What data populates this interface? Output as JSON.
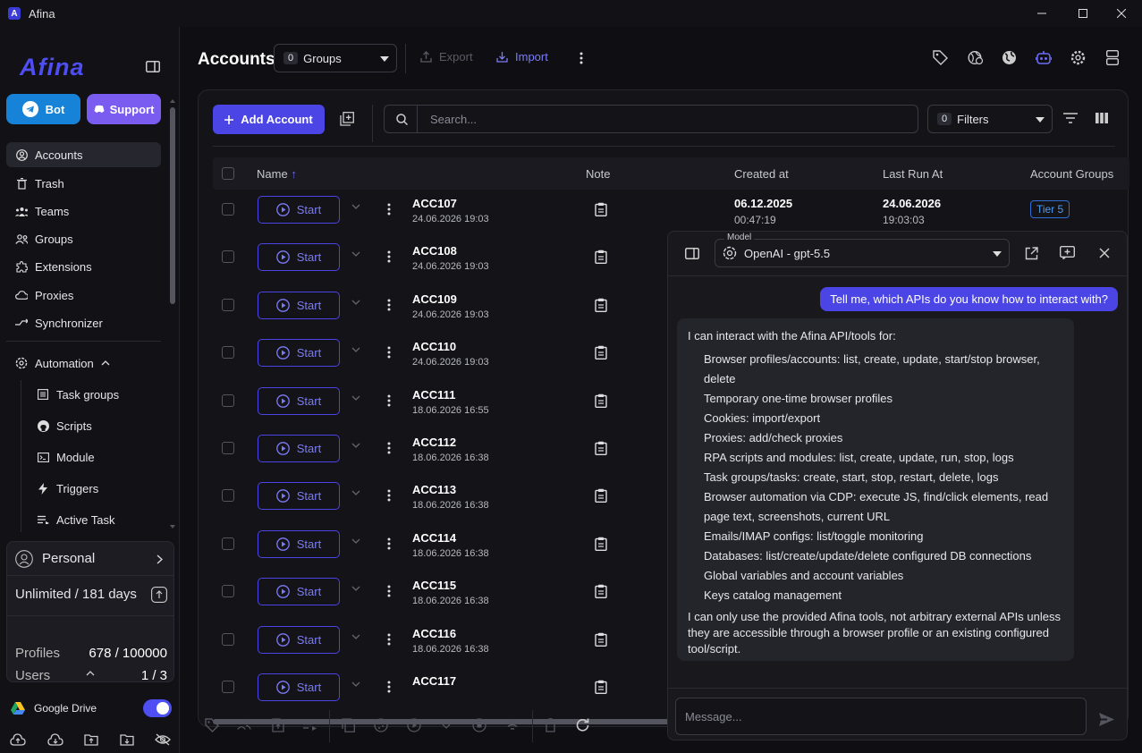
{
  "window": {
    "title": "Afina",
    "logo_letter": "A"
  },
  "sidebar": {
    "brand": "Afina",
    "bot_label": "Bot",
    "support_label": "Support",
    "nav": [
      {
        "label": "Accounts",
        "icon": "user-circle-icon",
        "active": true
      },
      {
        "label": "Trash",
        "icon": "trash-icon"
      },
      {
        "label": "Teams",
        "icon": "teams-icon"
      },
      {
        "label": "Groups",
        "icon": "groups-icon"
      },
      {
        "label": "Extensions",
        "icon": "puzzle-icon"
      },
      {
        "label": "Proxies",
        "icon": "cloud-icon"
      },
      {
        "label": "Synchronizer",
        "icon": "sync-icon"
      }
    ],
    "automation": {
      "label": "Automation",
      "items": [
        {
          "label": "Task groups"
        },
        {
          "label": "Scripts"
        },
        {
          "label": "Module"
        },
        {
          "label": "Triggers"
        },
        {
          "label": "Active Task"
        }
      ]
    },
    "plan": {
      "workspace": "Personal",
      "subscription": "Unlimited / 181 days",
      "profiles_label": "Profiles",
      "profiles_value": "678 / 100000",
      "users_label": "Users",
      "users_value": "1 / 3"
    },
    "google_drive": {
      "label": "Google Drive",
      "enabled": true
    }
  },
  "header": {
    "title": "Accounts",
    "groups_count": "0",
    "groups_label": "Groups",
    "export_label": "Export",
    "import_label": "Import"
  },
  "toolbar": {
    "add_account_label": "Add Account",
    "search_placeholder": "Search...",
    "filters_count": "0",
    "filters_label": "Filters"
  },
  "table": {
    "columns": {
      "name": "Name",
      "note": "Note",
      "created": "Created at",
      "lastrun": "Last Run At",
      "groups": "Account Groups"
    },
    "start_label": "Start",
    "rows": [
      {
        "name": "ACC107",
        "date": "24.06.2026 19:03",
        "created_date": "06.12.2025",
        "created_time": "00:47:19",
        "lastrun_date": "24.06.2026",
        "lastrun_time": "19:03:03",
        "group": "Tier 5"
      },
      {
        "name": "ACC108",
        "date": "24.06.2026 19:03"
      },
      {
        "name": "ACC109",
        "date": "24.06.2026 19:03"
      },
      {
        "name": "ACC110",
        "date": "24.06.2026 19:03"
      },
      {
        "name": "ACC111",
        "date": "18.06.2026 16:55"
      },
      {
        "name": "ACC112",
        "date": "18.06.2026 16:38"
      },
      {
        "name": "ACC113",
        "date": "18.06.2026 16:38"
      },
      {
        "name": "ACC114",
        "date": "18.06.2026 16:38"
      },
      {
        "name": "ACC115",
        "date": "18.06.2026 16:38"
      },
      {
        "name": "ACC116",
        "date": "18.06.2026 16:38"
      },
      {
        "name": "ACC117",
        "date": ""
      }
    ]
  },
  "chat": {
    "model_label": "Model",
    "model_value": "OpenAI - gpt-5.5",
    "user_message": "Tell me, which APIs do you know how to interact with?",
    "bot_intro": "I can interact with the Afina API/tools for:",
    "bot_items": [
      "Browser profiles/accounts: list, create, update, start/stop browser, delete",
      "Temporary one-time browser profiles",
      "Cookies: import/export",
      "Proxies: add/check proxies",
      "RPA scripts and modules: list, create, update, run, stop, logs",
      "Task groups/tasks: create, start, stop, restart, delete, logs",
      "Browser automation via CDP: execute JS, find/click elements, read page text, screenshots, current URL",
      "Emails/IMAP configs: list/toggle monitoring",
      "Databases: list/create/update/delete configured DB connections",
      "Global variables and account variables",
      "Keys catalog management"
    ],
    "bot_outro": "I can only use the provided Afina tools, not arbitrary external APIs unless they are accessible through a browser profile or an existing configured tool/script.",
    "input_placeholder": "Message..."
  },
  "colors": {
    "accent": "#4b45e6",
    "bot": "#1683d8",
    "support": "#7a5cf0",
    "tier": "#4e9cf5"
  }
}
